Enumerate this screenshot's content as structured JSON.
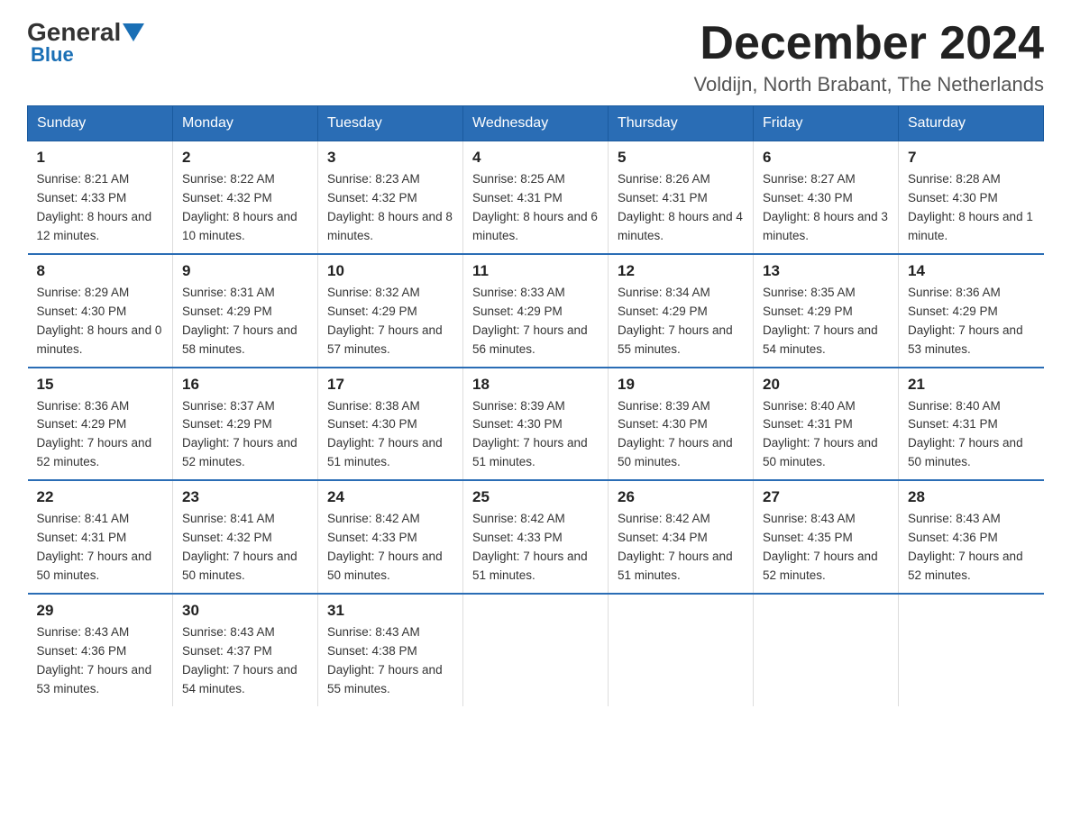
{
  "header": {
    "logo_general": "General",
    "logo_blue": "Blue",
    "title": "December 2024",
    "subtitle": "Voldijn, North Brabant, The Netherlands"
  },
  "days_of_week": [
    "Sunday",
    "Monday",
    "Tuesday",
    "Wednesday",
    "Thursday",
    "Friday",
    "Saturday"
  ],
  "weeks": [
    [
      {
        "day": "1",
        "sunrise": "8:21 AM",
        "sunset": "4:33 PM",
        "daylight": "8 hours and 12 minutes."
      },
      {
        "day": "2",
        "sunrise": "8:22 AM",
        "sunset": "4:32 PM",
        "daylight": "8 hours and 10 minutes."
      },
      {
        "day": "3",
        "sunrise": "8:23 AM",
        "sunset": "4:32 PM",
        "daylight": "8 hours and 8 minutes."
      },
      {
        "day": "4",
        "sunrise": "8:25 AM",
        "sunset": "4:31 PM",
        "daylight": "8 hours and 6 minutes."
      },
      {
        "day": "5",
        "sunrise": "8:26 AM",
        "sunset": "4:31 PM",
        "daylight": "8 hours and 4 minutes."
      },
      {
        "day": "6",
        "sunrise": "8:27 AM",
        "sunset": "4:30 PM",
        "daylight": "8 hours and 3 minutes."
      },
      {
        "day": "7",
        "sunrise": "8:28 AM",
        "sunset": "4:30 PM",
        "daylight": "8 hours and 1 minute."
      }
    ],
    [
      {
        "day": "8",
        "sunrise": "8:29 AM",
        "sunset": "4:30 PM",
        "daylight": "8 hours and 0 minutes."
      },
      {
        "day": "9",
        "sunrise": "8:31 AM",
        "sunset": "4:29 PM",
        "daylight": "7 hours and 58 minutes."
      },
      {
        "day": "10",
        "sunrise": "8:32 AM",
        "sunset": "4:29 PM",
        "daylight": "7 hours and 57 minutes."
      },
      {
        "day": "11",
        "sunrise": "8:33 AM",
        "sunset": "4:29 PM",
        "daylight": "7 hours and 56 minutes."
      },
      {
        "day": "12",
        "sunrise": "8:34 AM",
        "sunset": "4:29 PM",
        "daylight": "7 hours and 55 minutes."
      },
      {
        "day": "13",
        "sunrise": "8:35 AM",
        "sunset": "4:29 PM",
        "daylight": "7 hours and 54 minutes."
      },
      {
        "day": "14",
        "sunrise": "8:36 AM",
        "sunset": "4:29 PM",
        "daylight": "7 hours and 53 minutes."
      }
    ],
    [
      {
        "day": "15",
        "sunrise": "8:36 AM",
        "sunset": "4:29 PM",
        "daylight": "7 hours and 52 minutes."
      },
      {
        "day": "16",
        "sunrise": "8:37 AM",
        "sunset": "4:29 PM",
        "daylight": "7 hours and 52 minutes."
      },
      {
        "day": "17",
        "sunrise": "8:38 AM",
        "sunset": "4:30 PM",
        "daylight": "7 hours and 51 minutes."
      },
      {
        "day": "18",
        "sunrise": "8:39 AM",
        "sunset": "4:30 PM",
        "daylight": "7 hours and 51 minutes."
      },
      {
        "day": "19",
        "sunrise": "8:39 AM",
        "sunset": "4:30 PM",
        "daylight": "7 hours and 50 minutes."
      },
      {
        "day": "20",
        "sunrise": "8:40 AM",
        "sunset": "4:31 PM",
        "daylight": "7 hours and 50 minutes."
      },
      {
        "day": "21",
        "sunrise": "8:40 AM",
        "sunset": "4:31 PM",
        "daylight": "7 hours and 50 minutes."
      }
    ],
    [
      {
        "day": "22",
        "sunrise": "8:41 AM",
        "sunset": "4:31 PM",
        "daylight": "7 hours and 50 minutes."
      },
      {
        "day": "23",
        "sunrise": "8:41 AM",
        "sunset": "4:32 PM",
        "daylight": "7 hours and 50 minutes."
      },
      {
        "day": "24",
        "sunrise": "8:42 AM",
        "sunset": "4:33 PM",
        "daylight": "7 hours and 50 minutes."
      },
      {
        "day": "25",
        "sunrise": "8:42 AM",
        "sunset": "4:33 PM",
        "daylight": "7 hours and 51 minutes."
      },
      {
        "day": "26",
        "sunrise": "8:42 AM",
        "sunset": "4:34 PM",
        "daylight": "7 hours and 51 minutes."
      },
      {
        "day": "27",
        "sunrise": "8:43 AM",
        "sunset": "4:35 PM",
        "daylight": "7 hours and 52 minutes."
      },
      {
        "day": "28",
        "sunrise": "8:43 AM",
        "sunset": "4:36 PM",
        "daylight": "7 hours and 52 minutes."
      }
    ],
    [
      {
        "day": "29",
        "sunrise": "8:43 AM",
        "sunset": "4:36 PM",
        "daylight": "7 hours and 53 minutes."
      },
      {
        "day": "30",
        "sunrise": "8:43 AM",
        "sunset": "4:37 PM",
        "daylight": "7 hours and 54 minutes."
      },
      {
        "day": "31",
        "sunrise": "8:43 AM",
        "sunset": "4:38 PM",
        "daylight": "7 hours and 55 minutes."
      },
      null,
      null,
      null,
      null
    ]
  ],
  "labels": {
    "sunrise": "Sunrise:",
    "sunset": "Sunset:",
    "daylight": "Daylight:"
  }
}
